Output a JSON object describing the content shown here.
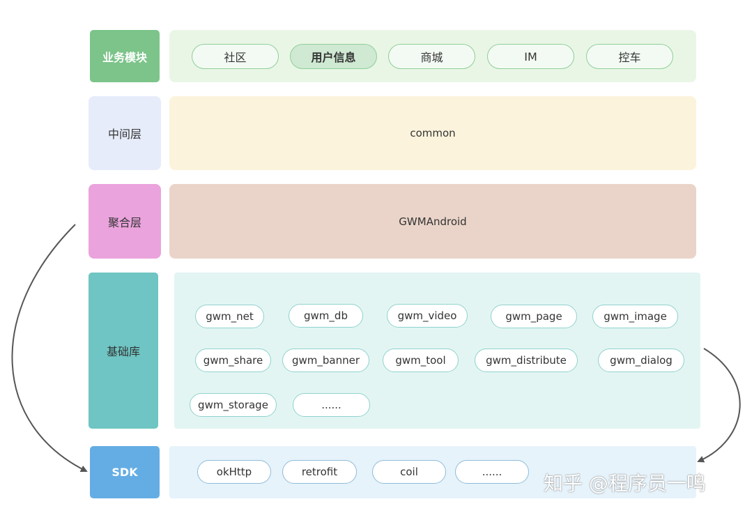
{
  "layers": {
    "business": {
      "label": "业务模块",
      "label_color": "#7cc48a",
      "panel_color": "#e9f6e6",
      "items": [
        "社区",
        "用户信息",
        "商城",
        "IM",
        "控车"
      ],
      "highlighted_item": "用户信息"
    },
    "middle": {
      "label": "中间层",
      "label_color": "#e6ecfa",
      "panel_color": "#fbf3dc",
      "content": "common"
    },
    "aggregation": {
      "label": "聚合层",
      "label_color": "#eaa3dc",
      "panel_color": "#ead4c9",
      "content": "GWMAndroid"
    },
    "base": {
      "label": "基础库",
      "label_color": "#6ec5c3",
      "panel_color": "#e3f5f2",
      "items": [
        "gwm_net",
        "gwm_db",
        "gwm_video",
        "gwm_page",
        "gwm_image",
        "gwm_share",
        "gwm_banner",
        "gwm_tool",
        "gwm_distribute",
        "gwm_dialog",
        "gwm_storage",
        "......"
      ]
    },
    "sdk": {
      "label": "SDK",
      "label_color": "#64ade4",
      "panel_color": "#e6f3fb",
      "items": [
        "okHttp",
        "retrofit",
        "coil",
        "......"
      ]
    }
  },
  "watermark": "知乎 @程序员一鸣"
}
